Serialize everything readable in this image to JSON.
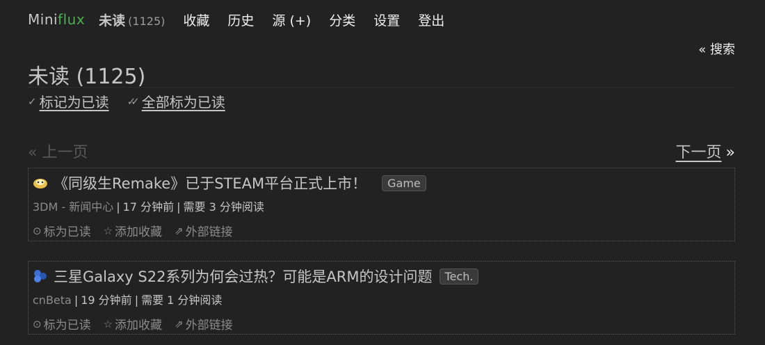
{
  "header": {
    "logo_mini": "Mini",
    "logo_flux": "flux",
    "nav": [
      {
        "label": "未读",
        "count": "(1125)"
      },
      {
        "label": "收藏"
      },
      {
        "label": "历史"
      },
      {
        "label": "源 (+)"
      },
      {
        "label": "分类"
      },
      {
        "label": "设置"
      },
      {
        "label": "登出"
      }
    ]
  },
  "search_link": "« 搜索",
  "page": {
    "title": "未读 (1125)",
    "actions": [
      {
        "icon": "check-icon",
        "glyph": "✓",
        "label": "标记为已读"
      },
      {
        "icon": "double-check-icon",
        "glyph": "✓✓",
        "label": "全部标为已读"
      }
    ]
  },
  "pagination": {
    "prev_arrow": "«",
    "prev_label": "上一页",
    "next_label": "下一页",
    "next_arrow": "»"
  },
  "items": [
    {
      "title": "《同级生Remake》已于STEAM平台正式上市！",
      "tag": "Game",
      "feed": "3DM - 新闻中心",
      "time": "17 分钟前",
      "reading": "需要 3 分钟阅读",
      "actions": [
        "标为已读",
        "添加收藏",
        "外部链接"
      ]
    },
    {
      "title": "三星Galaxy S22系列为何会过热？可能是ARM的设计问题",
      "tag": "Tech.",
      "feed": "cnBeta",
      "time": "19 分钟前",
      "reading": "需要 1 分钟阅读",
      "actions": [
        "标为已读",
        "添加收藏",
        "外部链接"
      ]
    }
  ],
  "glyphs": {
    "mark_read": "⊙",
    "star": "☆",
    "external": "⇗",
    "separator": "|"
  },
  "colors": {
    "background": "#222222",
    "text": "#c6c6c6",
    "logo_accent": "#4caf50",
    "muted": "#8c8c8c"
  }
}
